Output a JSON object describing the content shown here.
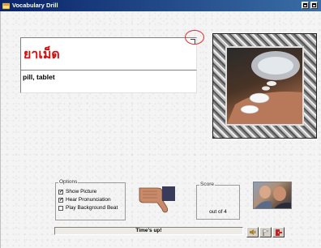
{
  "window": {
    "title": "Vocabulary Drill"
  },
  "drill": {
    "thai_word": "ยาเม็ด",
    "english_word": "pill, tablet"
  },
  "options": {
    "legend": "Options",
    "items": [
      {
        "label": "Show Picture",
        "checked": true
      },
      {
        "label": "Hear Pronunciation",
        "checked": true
      },
      {
        "label": "Play Background Beat",
        "checked": false
      }
    ]
  },
  "score": {
    "legend": "Score",
    "value": "",
    "out_of": "out of 4"
  },
  "status": {
    "text": "Time's up!"
  },
  "icons": {
    "app": "app-icon",
    "thumb": "thumbs-down-icon",
    "speaker": "speaker-icon",
    "flag": "flag-icon",
    "exit": "exit-icon"
  },
  "colors": {
    "thai_word": "#d01010",
    "highlight_circle": "#e03030",
    "titlebar": "#0a246a"
  }
}
